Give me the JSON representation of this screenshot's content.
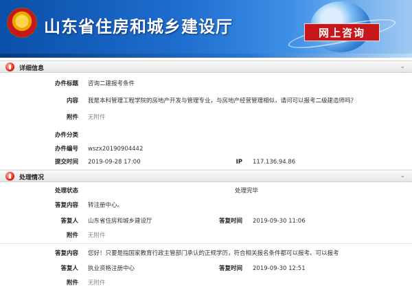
{
  "header": {
    "site_title": "山东省住房和城乡建设厅",
    "consult_label": "网上咨询"
  },
  "detail_section": {
    "title": "详细信息",
    "subject_label": "办件标题",
    "subject_value": "咨询二建报考条件",
    "content_label": "内容",
    "content_value": "我是本科管理工程学院的房地产开发与管理专业，与房地产经营管理相似，请问可以报考二级建造师吗？",
    "attachment_label": "附件",
    "attachment_value": "无附件",
    "category_label": "办件分类",
    "category_value": "",
    "number_label": "办件编号",
    "number_value": "wszx20190904442",
    "submit_time_label": "提交时间",
    "submit_time_value": "2019-09-28 17:00",
    "ip_label": "IP",
    "ip_value": "117.136.94.86"
  },
  "process_section": {
    "title": "处理情况",
    "status_label": "处理状态",
    "status_value": "处理完毕",
    "replies": [
      {
        "content_label": "答复内容",
        "content_value": "转注册中心。",
        "replier_label": "答复人",
        "replier_value": "山东省住房和城乡建设厅",
        "time_label": "答复时间",
        "time_value": "2019-09-30 11:06",
        "attachment_label": "附件",
        "attachment_value": "无附件"
      },
      {
        "content_label": "答复内容",
        "content_value": "您好！只要是指国家教育行政主管部门承认的正规学历，符合相关报名条件都可以报考。可以报考",
        "replier_label": "答复人",
        "replier_value": "执业资格注册中心",
        "time_label": "答复时间",
        "time_value": "2019-09-30 12:51",
        "attachment_label": "附件",
        "attachment_value": "无附件"
      }
    ]
  }
}
